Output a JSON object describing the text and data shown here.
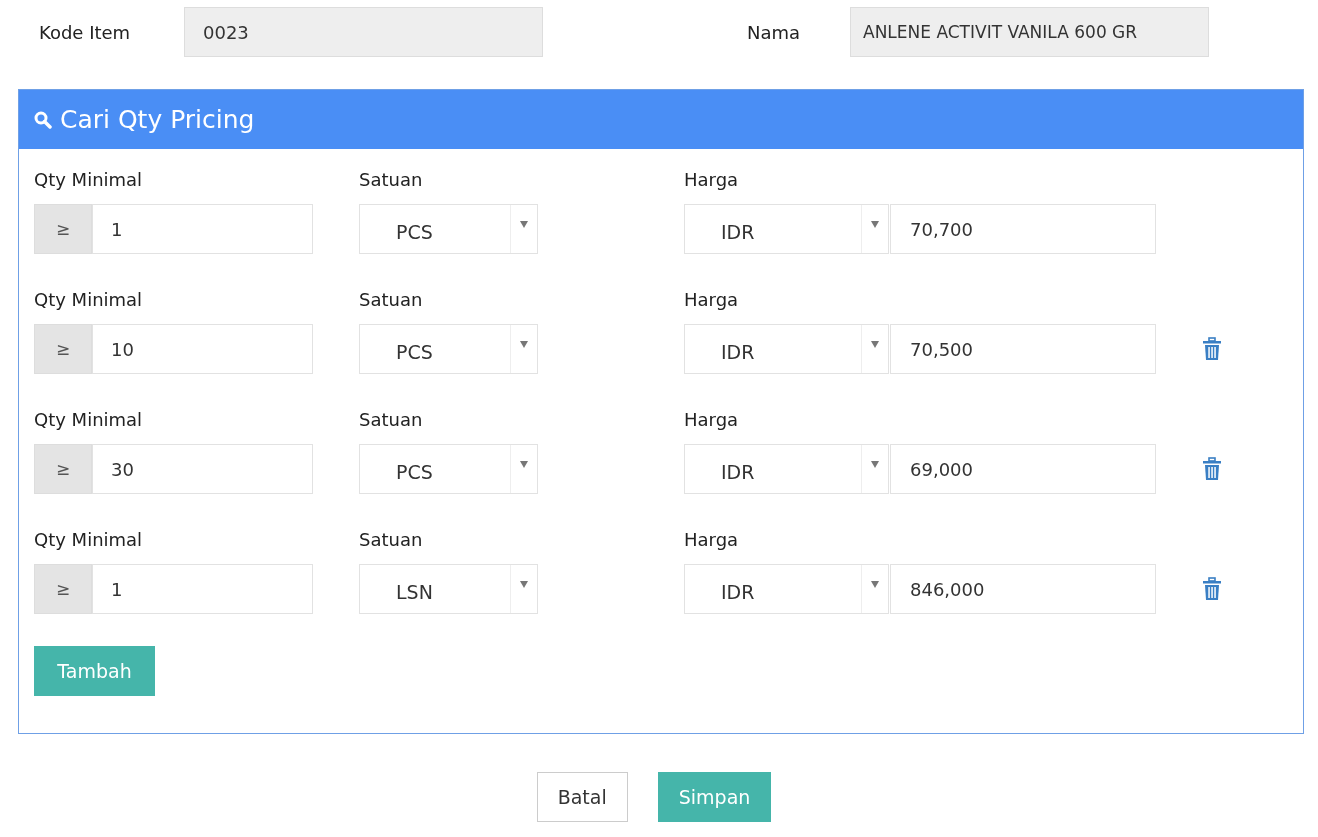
{
  "header_fields": [
    {
      "label": "Kode Item",
      "value": "0023"
    },
    {
      "label": "Nama",
      "value": "ANLENE ACTIVIT VANILA 600 GR"
    }
  ],
  "panel": {
    "title": "Cari Qty Pricing",
    "rows": [
      {
        "qty_label": "Qty Minimal",
        "operator": "≥",
        "qty": "1",
        "unit_label": "Satuan",
        "unit": "PCS",
        "price_label": "Harga",
        "currency": "IDR",
        "price": "70,700",
        "deletable": false
      },
      {
        "qty_label": "Qty Minimal",
        "operator": "≥",
        "qty": "10",
        "unit_label": "Satuan",
        "unit": "PCS",
        "price_label": "Harga",
        "currency": "IDR",
        "price": "70,500",
        "deletable": true
      },
      {
        "qty_label": "Qty Minimal",
        "operator": "≥",
        "qty": "30",
        "unit_label": "Satuan",
        "unit": "PCS",
        "price_label": "Harga",
        "currency": "IDR",
        "price": "69,000",
        "deletable": true
      },
      {
        "qty_label": "Qty Minimal",
        "operator": "≥",
        "qty": "1",
        "unit_label": "Satuan",
        "unit": "LSN",
        "price_label": "Harga",
        "currency": "IDR",
        "price": "846,000",
        "deletable": true
      }
    ],
    "add_button": "Tambah"
  },
  "buttons": [
    {
      "label": "Batal",
      "kind": "secondary"
    },
    {
      "label": "Simpan",
      "kind": "primary"
    }
  ]
}
